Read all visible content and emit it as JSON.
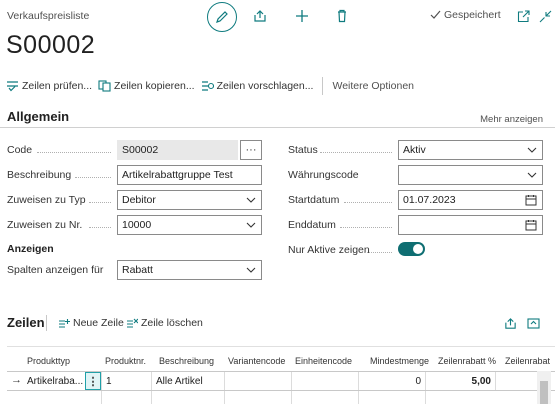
{
  "header": {
    "breadcrumb": "Verkaufspreisliste",
    "title": "S00002",
    "saved_label": "Gespeichert"
  },
  "actionbar": {
    "items": [
      {
        "label": "Zeilen prüfen...",
        "icon": "check-lines-icon"
      },
      {
        "label": "Zeilen kopieren...",
        "icon": "copy-lines-icon"
      },
      {
        "label": "Zeilen vorschlagen...",
        "icon": "suggest-lines-icon"
      }
    ],
    "more": "Weitere Optionen"
  },
  "general": {
    "title": "Allgemein",
    "more_link": "Mehr anzeigen",
    "left": {
      "code_label": "Code",
      "code_value": "S00002",
      "description_label": "Beschreibung",
      "description_value": "Artikelrabattgruppe Test",
      "assign_type_label": "Zuweisen zu Typ",
      "assign_type_value": "Debitor",
      "assign_no_label": "Zuweisen zu Nr.",
      "assign_no_value": "10000",
      "show_heading": "Anzeigen",
      "columns_label": "Spalten anzeigen für",
      "columns_value": "Rabatt"
    },
    "right": {
      "status_label": "Status",
      "status_value": "Aktiv",
      "currency_label": "Währungscode",
      "currency_value": "",
      "start_label": "Startdatum",
      "start_value": "01.07.2023",
      "end_label": "Enddatum",
      "end_value": "",
      "active_only_label": "Nur Aktive zeigen",
      "active_only_on": true
    }
  },
  "lines": {
    "title": "Zeilen",
    "new_line": "Neue Zeile",
    "delete_line": "Zeile löschen",
    "columns": [
      "Produkttyp",
      "Produktnr.",
      "Beschreibung",
      "Variantencode",
      "Einheitencode",
      "Mindestmenge",
      "Zeilenrabatt %",
      "Zeilenrabat"
    ],
    "rows": [
      {
        "produkttyp": "Artikelrabа...",
        "produktnr": "1",
        "beschreibung": "Alle Artikel",
        "variantencode": "",
        "einheitencode": "",
        "mindestmenge": "0",
        "zeilenrabatt": "5,00",
        "zeilenrabat2": ""
      }
    ]
  },
  "colors": {
    "accent": "#0f7b7f",
    "toggle_on": "#0f6e72"
  }
}
